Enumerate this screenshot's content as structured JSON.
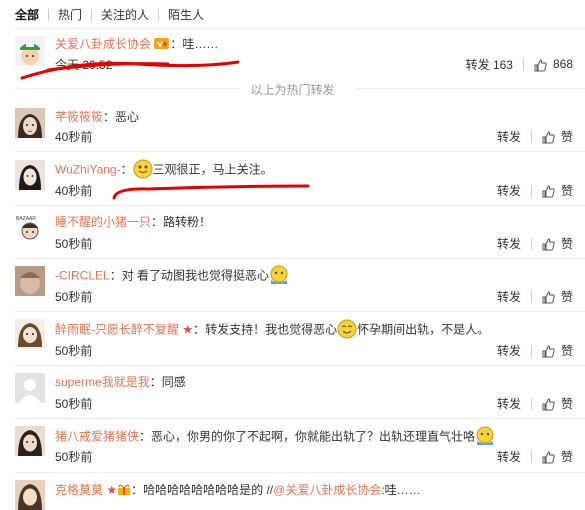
{
  "tabs": [
    "全部",
    "热门",
    "关注的人",
    "陌生人"
  ],
  "hot_separator": "以上为热门转发",
  "hot": {
    "name": "关爱八卦成长协会",
    "text": "：哇……",
    "time": "今天 20:52",
    "repost_label": "转发",
    "repost_count": "163",
    "like_count": "868"
  },
  "comments": [
    {
      "name": "芊筱筱筱",
      "text": "：恶心",
      "time": "40秒前",
      "repost": "转发",
      "like": "赞"
    },
    {
      "name": "WuZhiYang-",
      "text": "：",
      "text2": "三观很正，马上关注。",
      "time": "40秒前",
      "repost": "转发",
      "like": "赞"
    },
    {
      "name": "睡不醒的小猪一只",
      "text": "：路转粉！",
      "time": "50秒前",
      "repost": "转发",
      "like": "赞"
    },
    {
      "name": "-CIRCLEL",
      "text": "：对 看了动图我也觉得挺恶心",
      "time": "50秒前",
      "repost": "转发",
      "like": "赞"
    },
    {
      "name": "醉雨眠-只愿长醉不复醒",
      "text": "：转发支持！我也觉得恶心",
      "text2": "怀孕期间出轨，不是人。",
      "time": "50秒前",
      "repost": "转发",
      "like": "赞"
    },
    {
      "name": "superme我就是我",
      "text": "：同感",
      "time": "50秒前",
      "repost": "转发",
      "like": "赞"
    },
    {
      "name": "猪八戒爱猪猪侠",
      "text": "：恶心，你男的你了不起啊，你就能出轨了？出轨还理直气壮咯",
      "time": "50秒前",
      "repost": "转发",
      "like": "赞"
    },
    {
      "name": "克格莫莫",
      "text": "：哈哈哈哈哈哈哈哈是的 //",
      "mention": "@关爱八卦成长协会",
      "text3": ":哇……"
    }
  ],
  "colors": {
    "name": "#eb7350",
    "annotation": "#e60000"
  }
}
